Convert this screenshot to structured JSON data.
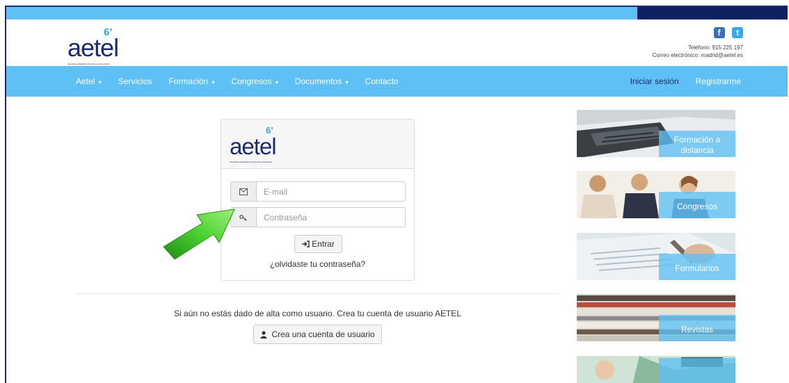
{
  "brand": {
    "logo_text": "aetel",
    "logo_mark": "6’",
    "logo_sub": "Asociación Española Técnicos de Laboratorio"
  },
  "social": [
    {
      "icon": "facebook-icon",
      "glyph": "f"
    },
    {
      "icon": "twitter-icon",
      "glyph": "t"
    }
  ],
  "contact": {
    "phone": "Teléfono: 915 225 197",
    "email": "Correo electrónico: madrid@aetel.es"
  },
  "nav": {
    "items": [
      {
        "label": "Aetel",
        "dropdown": true
      },
      {
        "label": "Servicios",
        "dropdown": false
      },
      {
        "label": "Formación",
        "dropdown": true
      },
      {
        "label": "Congresos",
        "dropdown": true
      },
      {
        "label": "Documentos",
        "dropdown": true
      },
      {
        "label": "Contacto",
        "dropdown": false
      }
    ],
    "login": "Iniciar sesión",
    "register": "Registrarme",
    "caret": "▾"
  },
  "login": {
    "email_placeholder": "E-mail",
    "password_placeholder": "Contraseña",
    "submit_label": "Entrar",
    "forgot_label": "¿olvidaste tu contraseña?"
  },
  "signup": {
    "text": "Si aún no estás dado de alta como usuario. Crea tu cuenta de usuario AETEL",
    "button_label": "Crea una cuenta de usuario"
  },
  "tiles": [
    {
      "label": "Formación a distancia"
    },
    {
      "label": "Congresos"
    },
    {
      "label": "Formularios"
    },
    {
      "label": "Revistas"
    },
    {
      "label": ""
    }
  ],
  "colors": {
    "nav_bg": "#5ec0f4",
    "topbar_dark": "#0d2060",
    "logo": "#1d2a6b",
    "arrow": "#3cc22a"
  }
}
